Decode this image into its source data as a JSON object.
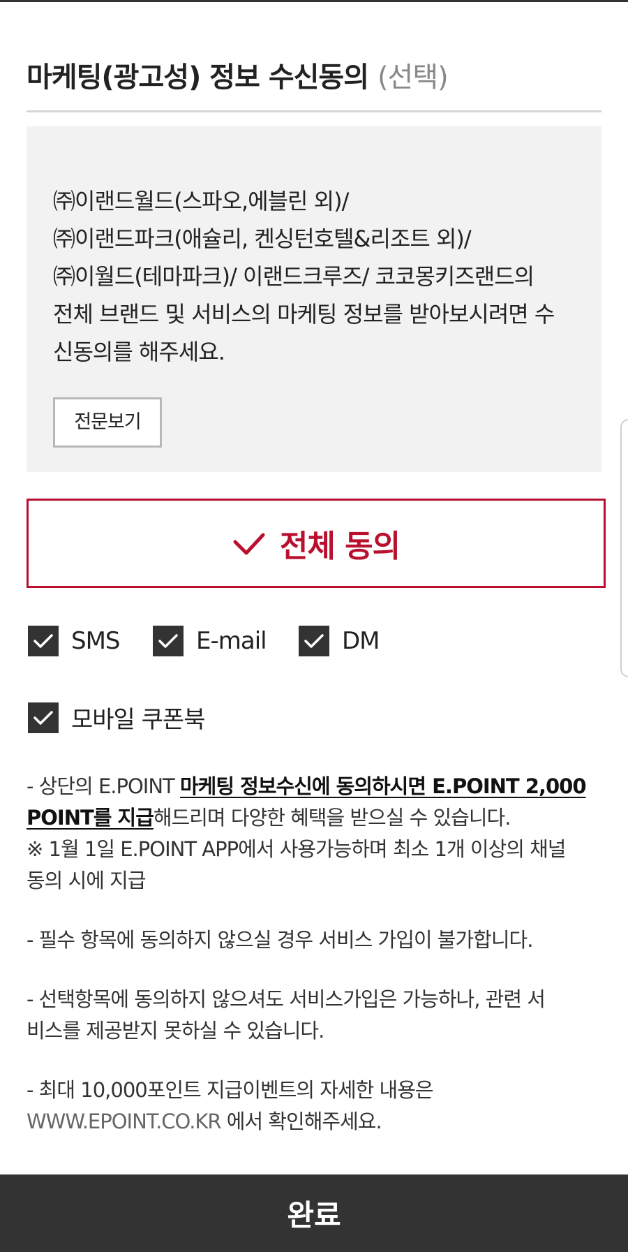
{
  "section": {
    "title": "마케팅(광고성) 정보 수신동의",
    "title_suffix": "(선택)"
  },
  "info_box": {
    "lines": [
      "㈜이랜드월드(스파오,에블린 외)/",
      "㈜이랜드파크(애슐리, 켄싱턴호텔&리조트 외)/",
      "㈜이월드(테마파크)/ 이랜드크루즈/ 코코몽키즈랜드의",
      "전체 브랜드 및 서비스의 마케팅 정보를 받아보시려면 수",
      "신동의를 해주세요."
    ],
    "fulltext_button": "전문보기"
  },
  "agree_all": {
    "label": "전체 동의",
    "accent_color": "#b8102e"
  },
  "channels": [
    {
      "label": "SMS",
      "checked": true
    },
    {
      "label": "E-mail",
      "checked": true
    },
    {
      "label": "DM",
      "checked": true
    },
    {
      "label": "모바일 쿠폰북",
      "checked": true
    }
  ],
  "notes": {
    "n1_prefix": "-  상단의 E.POINT ",
    "n1_bold": "마케팅 정보수신에 동의하시면 E.POINT 2,000",
    "n1_bold2": "POINT를 지급",
    "n1_rest": "해드리며 다양한 혜택을 받으실 수 있습니다.",
    "n1_line3": "※ 1월 1일 E.POINT APP에서 사용가능하며 최소 1개 이상의 채널",
    "n1_line4": "동의 시에 지급",
    "n2": "-  필수 항목에 동의하지 않으실 경우 서비스 가입이 불가합니다.",
    "n3_line1": "-  선택항목에 동의하지 않으셔도 서비스가입은 가능하나, 관련 서",
    "n3_line2": "비스를 제공받지 못하실 수 있습니다.",
    "n4_line1": "-  최대 10,000포인트 지급이벤트의 자세한 내용은",
    "n4_url": "WWW.EPOINT.CO.KR",
    "n4_rest": " 에서 확인해주세요."
  },
  "footer": {
    "done_label": "완료"
  }
}
